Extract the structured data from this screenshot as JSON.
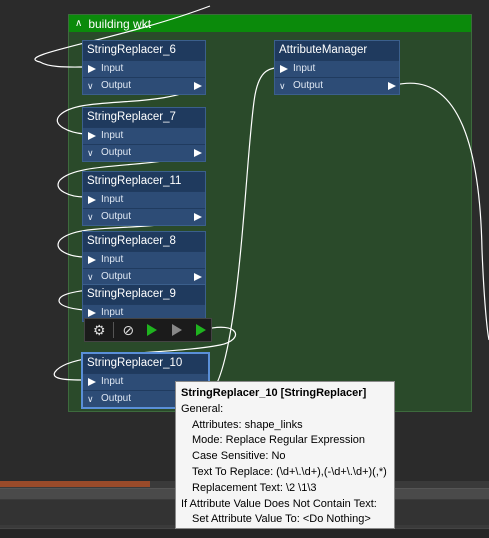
{
  "bookmark": {
    "title": "building wkt"
  },
  "nodes": [
    {
      "title": "StringReplacer_6",
      "input": "Input",
      "output": "Output"
    },
    {
      "title": "StringReplacer_7",
      "input": "Input",
      "output": "Output"
    },
    {
      "title": "StringReplacer_11",
      "input": "Input",
      "output": "Output"
    },
    {
      "title": "StringReplacer_8",
      "input": "Input",
      "output": "Output"
    },
    {
      "title": "StringReplacer_9",
      "input": "Input"
    },
    {
      "title": "StringReplacer_10",
      "input": "Input",
      "output": "Output"
    },
    {
      "title": "AttributeManager",
      "input": "Input",
      "output": "Output"
    }
  ],
  "toolbar": {
    "icons": [
      "gear-icon",
      "disable-icon",
      "run-to-this-icon",
      "run-from-this-icon",
      "run-just-this-icon"
    ]
  },
  "tooltip": {
    "title": "StringReplacer_10 [StringReplacer]",
    "section_general": "General:",
    "attributes": "Attributes: shape_links",
    "mode": "Mode: Replace Regular Expression",
    "case_sensitive": "Case Sensitive: No",
    "text_to_replace": "Text To Replace: (\\d+\\.\\d+),(-\\d+\\.\\d+)(,*)",
    "replacement_text": "Replacement Text: \\2 \\1\\3",
    "section_if": "If Attribute Value Does Not Contain Text:",
    "set_value": "Set Attribute Value To: <Do Nothing>"
  },
  "colors": {
    "bookmark_header": "#0b8a0b",
    "bookmark_body": "#2a4a2a",
    "node_body": "#28456b",
    "selection": "#5a8fd8",
    "run_green": "#1fb31f"
  }
}
